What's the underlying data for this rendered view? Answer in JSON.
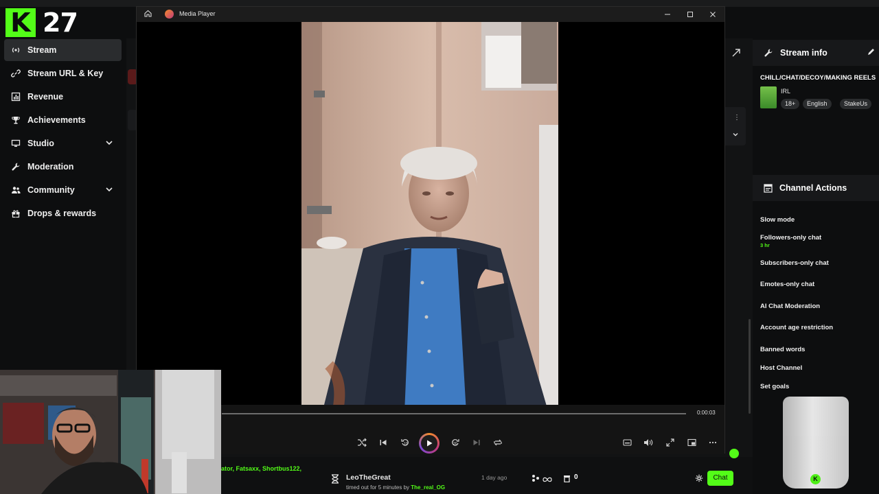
{
  "logo": {
    "letter": "K",
    "number": "27"
  },
  "sidebar": {
    "items": [
      {
        "label": "Stream",
        "icon": "broadcast-icon",
        "active": true
      },
      {
        "label": "Stream URL & Key",
        "icon": "link-icon"
      },
      {
        "label": "Revenue",
        "icon": "chart-icon"
      },
      {
        "label": "Achievements",
        "icon": "trophy-icon"
      },
      {
        "label": "Studio",
        "icon": "monitor-icon",
        "expandable": true
      },
      {
        "label": "Moderation",
        "icon": "wrench-icon"
      },
      {
        "label": "Community",
        "icon": "users-icon",
        "expandable": true
      },
      {
        "label": "Drops & rewards",
        "icon": "gift-icon"
      }
    ]
  },
  "player": {
    "title": "Media Player",
    "time": "0:00:03",
    "progress": 0.0
  },
  "chat": {
    "mentions": "ator, Fatsaxx, Shortbus122,",
    "event": {
      "user": "LeoTheGreat",
      "when": "1 day ago",
      "detail_prefix": "timed out for 5 minutes by",
      "detail_by": "The_real_OG"
    },
    "count": "0",
    "chat_button": "Chat"
  },
  "right": {
    "stream_info": {
      "heading": "Stream info",
      "title": "CHILL/CHAT/DECOY/MAKING REELS",
      "category": "IRL",
      "tags": [
        "18+",
        "English",
        "StakeUs"
      ]
    },
    "channel_actions": {
      "heading": "Channel Actions",
      "items": [
        {
          "label": "Slow mode"
        },
        {
          "label": "Followers-only chat",
          "sub": "3 hr"
        },
        {
          "label": "Subscribers-only chat"
        },
        {
          "label": "Emotes-only chat"
        },
        {
          "label": "AI Chat Moderation"
        },
        {
          "label": "Account age restriction"
        },
        {
          "label": "Banned words"
        },
        {
          "label": "Host Channel"
        },
        {
          "label": "Set goals"
        }
      ]
    }
  },
  "colors": {
    "accent": "#53fc18",
    "panel": "#17181a",
    "background": "#0d0e0f"
  }
}
